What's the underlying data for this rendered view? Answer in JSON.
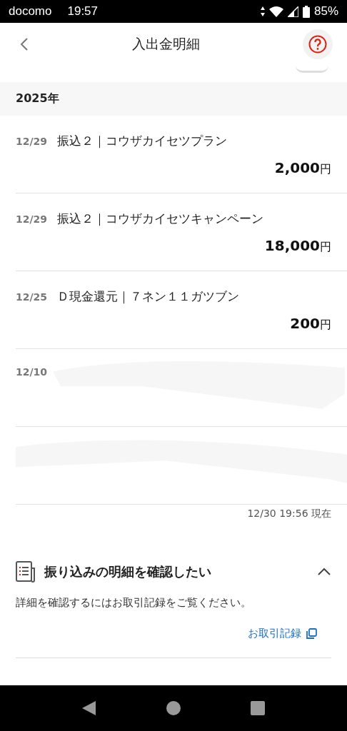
{
  "status_bar": {
    "carrier": "docomo",
    "time": "19:57",
    "battery": "85%"
  },
  "header": {
    "title": "入出金明細"
  },
  "year": "2025年",
  "transactions": [
    {
      "date": "12/29",
      "description": "振込２｜コウザカイセツプラン",
      "amount": "2,000",
      "currency": "円",
      "redacted": false
    },
    {
      "date": "12/29",
      "description": "振込２｜コウザカイセツキャンペーン",
      "amount": "18,000",
      "currency": "円",
      "redacted": false
    },
    {
      "date": "12/25",
      "description": "Ｄ現金還元｜７ネン１１ガツブン",
      "amount": "200",
      "currency": "円",
      "redacted": false
    },
    {
      "date": "12/10",
      "redacted": true
    },
    {
      "redacted": true
    }
  ],
  "as_of": "12/30 19:56 現在",
  "help": {
    "title": "振り込みの明細を確認したい",
    "expanded": true,
    "body": "詳細を確認するにはお取引記録をご覧ください。",
    "link": "お取引記録"
  }
}
